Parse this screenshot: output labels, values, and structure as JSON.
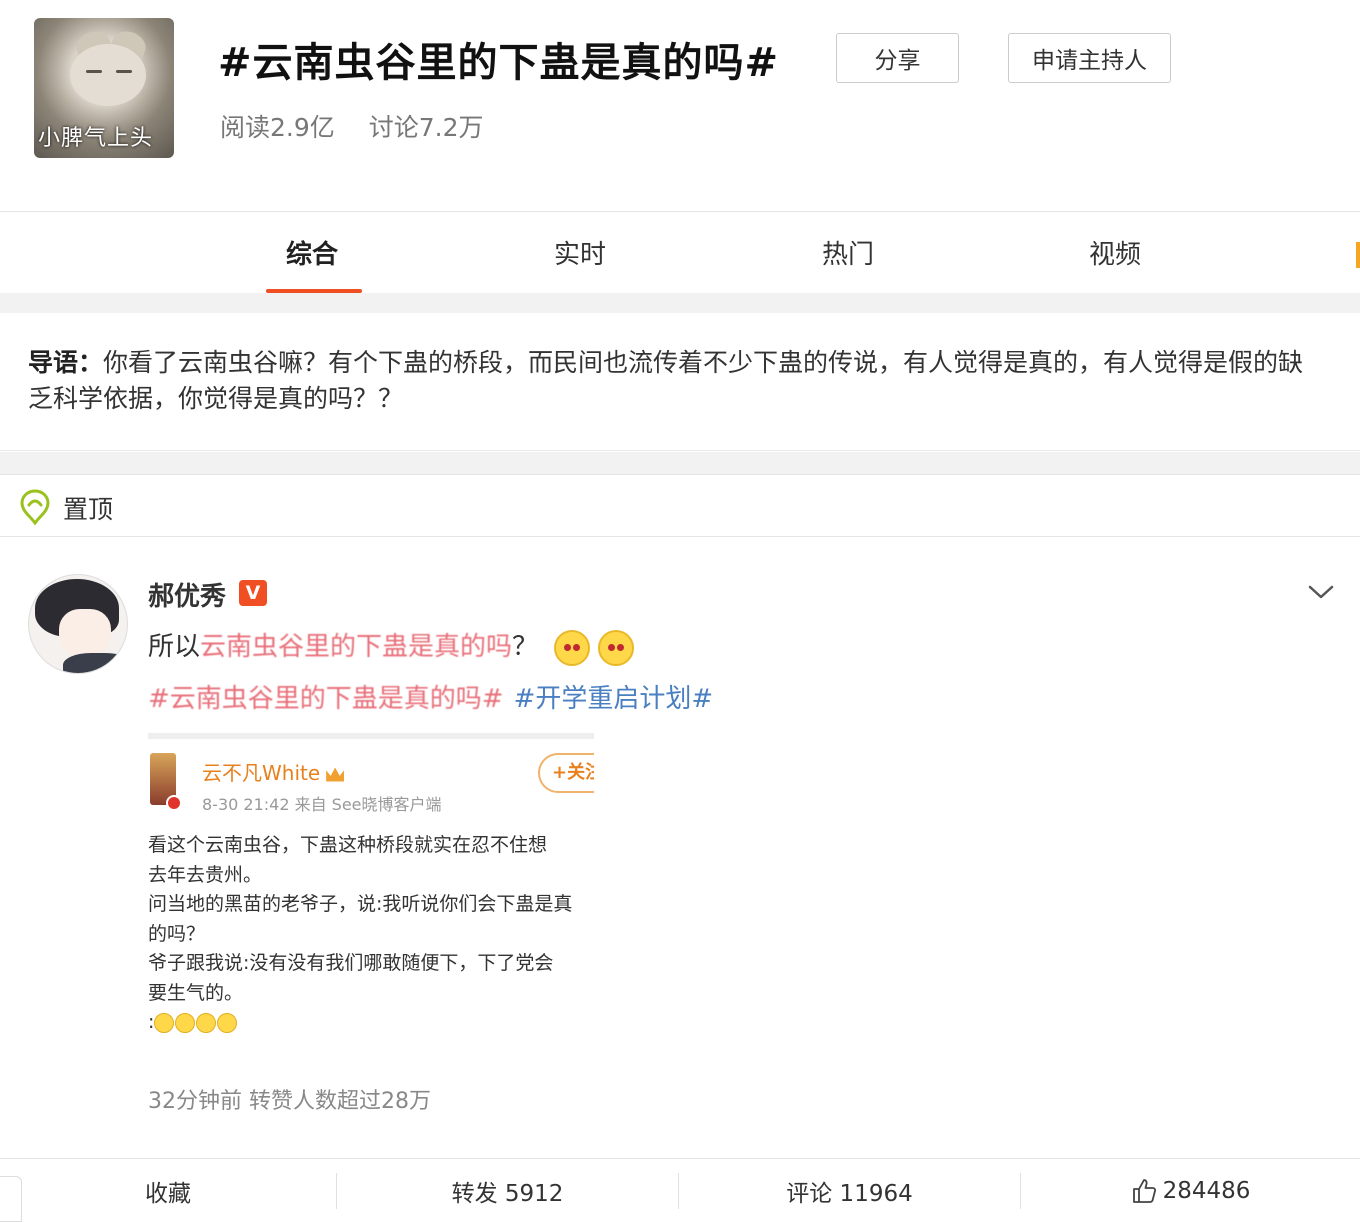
{
  "header": {
    "avatar_caption": "小脾气上头",
    "title": "#云南虫谷里的下蛊是真的吗#",
    "reads": "阅读2.9亿",
    "discussions": "讨论7.2万",
    "share_label": "分享",
    "apply_host_label": "申请主持人"
  },
  "tabs": [
    {
      "label": "综合",
      "active": true
    },
    {
      "label": "实时",
      "active": false
    },
    {
      "label": "热门",
      "active": false
    },
    {
      "label": "视频",
      "active": false
    }
  ],
  "intro": {
    "label": "导语：",
    "text": "你看了云南虫谷嘛？有个下蛊的桥段，而民间也流传着不少下蛊的传说，有人觉得是真的，有人觉得是假的缺乏科学依据，你觉得是真的吗？？"
  },
  "pinned": {
    "label": "置顶"
  },
  "post": {
    "username": "郝优秀",
    "verified_badge": "V",
    "text_prefix": "所以",
    "text_link": "云南虫谷里的下蛊是真的吗",
    "text_suffix": "？",
    "hashtag1": "#云南虫谷里的下蛊是真的吗#",
    "hashtag2": "#开学重启计划#",
    "footer": "32分钟前 转赞人数超过28万",
    "embed": {
      "name": "云不凡White",
      "meta": "8-30 21:42  来自 See晓博客户端",
      "follow_label": "+关注",
      "lines": [
        "看这个云南虫谷，下蛊这种桥段就实在忍不住想",
        "去年去贵州。",
        "问当地的黑苗的老爷子，说:我听说你们会下蛊是真",
        "的吗？",
        "爷子跟我说:没有没有我们哪敢随便下，下了党会",
        "要生气的。",
        ":"
      ]
    }
  },
  "actions": {
    "favorite": "收藏",
    "repost": "转发 5912",
    "comment": "评论 11964",
    "like": "284486"
  },
  "colors": {
    "accent": "#f04e23",
    "link": "#4a7fc1",
    "highlight": "#e8707a",
    "orange": "#e8801e"
  }
}
